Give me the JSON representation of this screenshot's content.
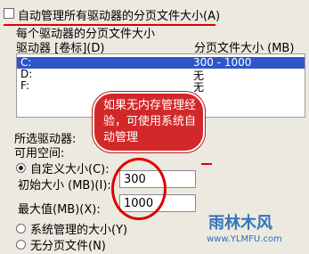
{
  "top_option": {
    "label": "自动管理所有驱动器的分页文件大小(A)"
  },
  "section_title": "每个驱动器的分页文件大小",
  "list": {
    "col_drive": "驱动器 [卷标](D)",
    "col_size": "分页文件大小 (MB)",
    "rows": [
      {
        "drive": "C:",
        "size": "300 - 1000",
        "selected": true
      },
      {
        "drive": "D:",
        "size": "无"
      },
      {
        "drive": "F:",
        "size": "无"
      }
    ]
  },
  "selected_drive_label": "所选驱动器:",
  "available_space_label": "可用空间:",
  "custom_size": {
    "label": "自定义大小(C):"
  },
  "initial_size": {
    "label": "初始大小 (MB)(I):",
    "value": "300"
  },
  "max_size": {
    "label": "最大值(MB)(X):",
    "value": "1000"
  },
  "system_managed": {
    "label": "系统管理的大小(Y)"
  },
  "no_paging": {
    "label": "无分页文件(N)"
  },
  "annotation": {
    "text": "如果无内存管理经验，可使用系统自动管理"
  },
  "watermark": {
    "name": "雨林木风",
    "url": "www.YLMFU.com"
  }
}
